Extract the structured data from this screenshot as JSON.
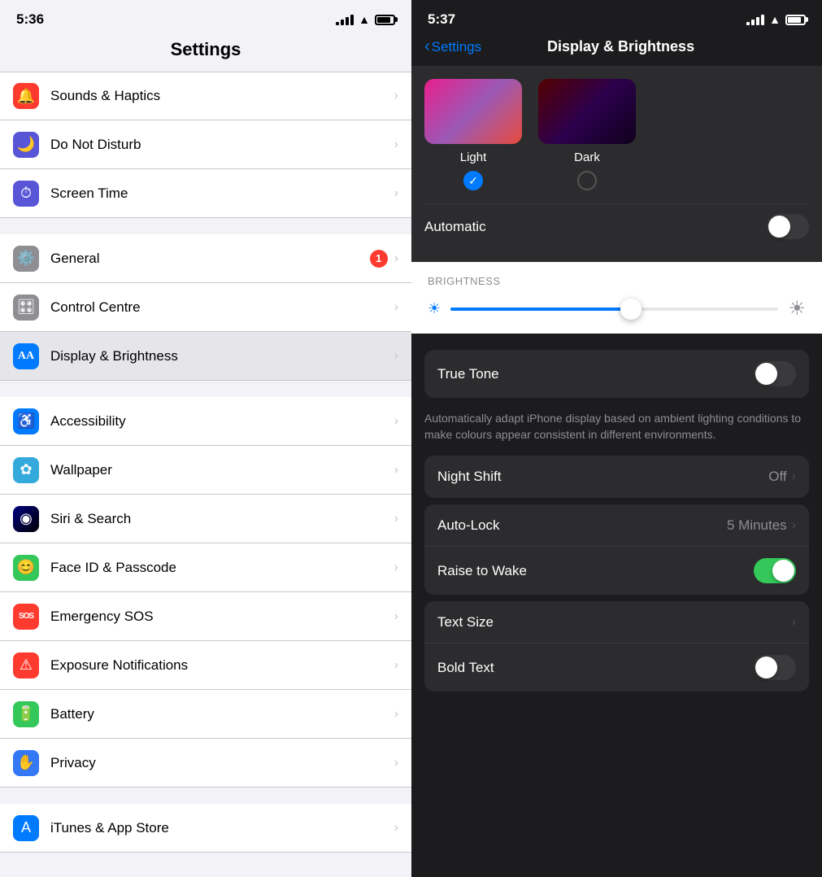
{
  "left": {
    "statusBar": {
      "time": "5:36",
      "signal": [
        2,
        3,
        4,
        5
      ],
      "battery": 75
    },
    "title": "Settings",
    "sections": [
      {
        "items": [
          {
            "id": "sounds-haptics",
            "label": "Sounds & Haptics",
            "iconBg": "#ff3b30",
            "iconChar": "🔔"
          },
          {
            "id": "do-not-disturb",
            "label": "Do Not Disturb",
            "iconBg": "#5856d6",
            "iconChar": "🌙"
          },
          {
            "id": "screen-time",
            "label": "Screen Time",
            "iconBg": "#5856d6",
            "iconChar": "⏱"
          }
        ]
      },
      {
        "items": [
          {
            "id": "general",
            "label": "General",
            "iconBg": "#8e8e93",
            "iconChar": "⚙️",
            "badge": "1"
          },
          {
            "id": "control-centre",
            "label": "Control Centre",
            "iconBg": "#8e8e93",
            "iconChar": "🎛"
          },
          {
            "id": "display-brightness",
            "label": "Display & Brightness",
            "iconBg": "#007aff",
            "iconChar": "AA",
            "selected": true
          }
        ]
      },
      {
        "items": [
          {
            "id": "accessibility",
            "label": "Accessibility",
            "iconBg": "#007aff",
            "iconChar": "♿"
          },
          {
            "id": "wallpaper",
            "label": "Wallpaper",
            "iconBg": "#34aadc",
            "iconChar": "✿"
          },
          {
            "id": "siri-search",
            "label": "Siri & Search",
            "iconBg": "#000",
            "iconChar": "◉"
          },
          {
            "id": "face-id-passcode",
            "label": "Face ID & Passcode",
            "iconBg": "#34c759",
            "iconChar": "😊"
          },
          {
            "id": "emergency-sos",
            "label": "Emergency SOS",
            "iconBg": "#ff3b30",
            "iconChar": "SOS"
          },
          {
            "id": "exposure-notifications",
            "label": "Exposure Notifications",
            "iconBg": "#ff3b30",
            "iconChar": "⚠"
          },
          {
            "id": "battery",
            "label": "Battery",
            "iconBg": "#34c759",
            "iconChar": "🔋"
          },
          {
            "id": "privacy",
            "label": "Privacy",
            "iconBg": "#3478f6",
            "iconChar": "✋"
          }
        ]
      },
      {
        "items": [
          {
            "id": "itunes-app-store",
            "label": "iTunes & App Store",
            "iconBg": "#007aff",
            "iconChar": "A"
          }
        ]
      }
    ]
  },
  "right": {
    "statusBar": {
      "time": "5:37"
    },
    "backLabel": "Settings",
    "title": "Display & Brightness",
    "appearance": {
      "lightLabel": "Light",
      "darkLabel": "Dark",
      "automaticLabel": "Automatic",
      "lightSelected": true
    },
    "brightness": {
      "sectionLabel": "BRIGHTNESS",
      "sliderPercent": 55
    },
    "trueTone": {
      "label": "True Tone",
      "enabled": false,
      "description": "Automatically adapt iPhone display based on ambient lighting conditions to make colours appear consistent in different environments."
    },
    "rows": [
      {
        "id": "night-shift",
        "label": "Night Shift",
        "value": "Off",
        "hasChevron": true
      },
      {
        "id": "auto-lock",
        "label": "Auto-Lock",
        "value": "5 Minutes",
        "hasChevron": true
      },
      {
        "id": "raise-to-wake",
        "label": "Raise to Wake",
        "value": "",
        "toggle": true,
        "toggleOn": true
      },
      {
        "id": "text-size",
        "label": "Text Size",
        "value": "",
        "hasChevron": true
      },
      {
        "id": "bold-text",
        "label": "Bold Text",
        "value": "",
        "toggle": true,
        "toggleOn": false
      }
    ]
  }
}
